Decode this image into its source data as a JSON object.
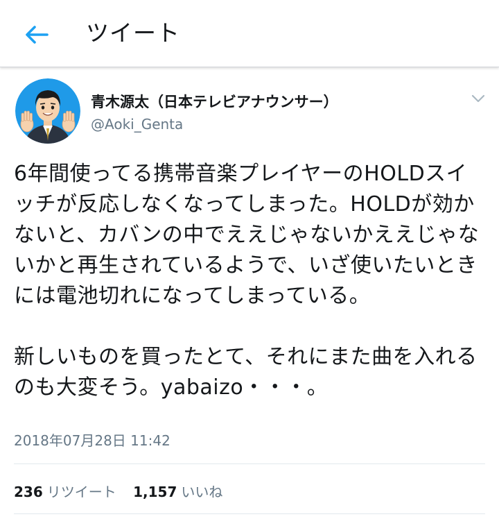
{
  "header": {
    "title": "ツイート",
    "back_icon": "arrow-left-icon",
    "accent_color": "#1da1f2"
  },
  "tweet": {
    "author": {
      "display_name": "青木源太（日本テレビアナウンサー）",
      "handle": "@Aoki_Genta"
    },
    "menu_icon": "chevron-down-icon",
    "body": {
      "paragraph_1": "6年間使ってる携帯音楽プレイヤーのHOLDスイッチが反応しなくなってしまった。HOLDが効かないと、カバンの中でええじゃないかええじゃないかと再生されているようで、いざ使いたいときには電池切れになってしまっている。",
      "paragraph_2": "新しいものを買ったとて、それにまた曲を入れるのも大変そう。yabaizo・・・。"
    },
    "timestamp": "2018年07月28日 11:42",
    "stats": {
      "retweets_count": "236",
      "retweets_label": "リツイート",
      "likes_count": "1,157",
      "likes_label": "いいね"
    }
  }
}
